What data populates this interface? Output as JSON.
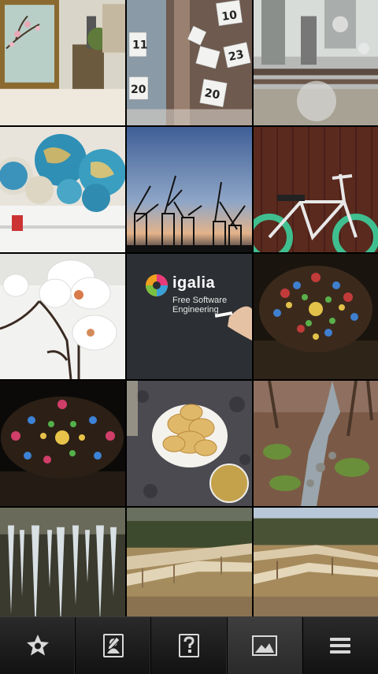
{
  "gallery": {
    "tiles": [
      {
        "subject": "vintage-interior-photo"
      },
      {
        "subject": "numbered-paper-tags-photo"
      },
      {
        "subject": "train-window-photo"
      },
      {
        "subject": "globes-on-shelf-photo"
      },
      {
        "subject": "harbor-cranes-dusk-photo"
      },
      {
        "subject": "bmx-bicycle-photo"
      },
      {
        "subject": "white-orchid-photo"
      },
      {
        "subject": "igalia-chalkboard-photo"
      },
      {
        "subject": "rose-window-photo"
      },
      {
        "subject": "rose-window-photo-2"
      },
      {
        "subject": "potato-chips-plate-photo"
      },
      {
        "subject": "forest-stream-photo"
      },
      {
        "subject": "icicles-cave-photo"
      },
      {
        "subject": "wooden-walkway-photo"
      },
      {
        "subject": "wooden-walkway-photo-2"
      }
    ],
    "igalia": {
      "brand": "igalia",
      "tagline_line1": "Free Software",
      "tagline_line2": "Engineering"
    }
  },
  "toolbar": {
    "buttons": [
      {
        "icon": "favorite-star-icon",
        "selected": false
      },
      {
        "icon": "profile-icon",
        "selected": false
      },
      {
        "icon": "unknown-profile-icon",
        "selected": false
      },
      {
        "icon": "gallery-icon",
        "selected": true
      },
      {
        "icon": "menu-icon",
        "selected": false
      }
    ]
  }
}
